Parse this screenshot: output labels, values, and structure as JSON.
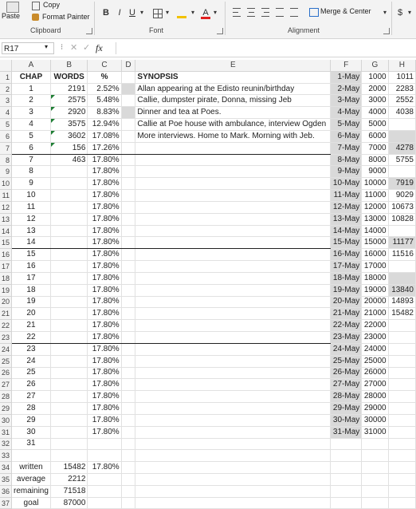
{
  "ribbon": {
    "clipboard": {
      "paste": "Paste",
      "copy": "Copy",
      "format_painter": "Format Painter",
      "label": "Clipboard"
    },
    "font": {
      "bold": "B",
      "italic": "I",
      "underline": "U",
      "font_color": "A",
      "label": "Font"
    },
    "alignment": {
      "merge_center": "Merge & Center",
      "label": "Alignment"
    },
    "number": {
      "currency": "$"
    }
  },
  "formula_bar": {
    "name_box": "R17",
    "fx": "fx",
    "value": ""
  },
  "columns": [
    "A",
    "B",
    "C",
    "D",
    "E",
    "F",
    "G",
    "H"
  ],
  "header_row": {
    "chap": "CHAP",
    "words": "WORDS",
    "pct": "%",
    "synopsis": "SYNOPSIS"
  },
  "rows": [
    {
      "n": "1",
      "a": "CHAP",
      "b": "WORDS",
      "c": "%",
      "e": "SYNOPSIS",
      "f": "1-May",
      "g": "1000",
      "h": "1011"
    },
    {
      "n": "2",
      "a": "1",
      "b": "2191",
      "c": "2.52%",
      "e": "Allan appearing at the Edisto reunin/birthday",
      "f": "2-May",
      "g": "2000",
      "h": "2283"
    },
    {
      "n": "3",
      "a": "2",
      "b": "2575",
      "c": "5.48%",
      "e": "Callie, dumpster pirate, Donna, missing Jeb",
      "f": "3-May",
      "g": "3000",
      "h": "2552"
    },
    {
      "n": "4",
      "a": "3",
      "b": "2920",
      "c": "8.83%",
      "e": "Dinner and tea at Poes.",
      "f": "4-May",
      "g": "4000",
      "h": "4038"
    },
    {
      "n": "5",
      "a": "4",
      "b": "3575",
      "c": "12.94%",
      "e": "Callie at Poe house with ambulance, interview Ogden",
      "f": "5-May",
      "g": "5000",
      "h": ""
    },
    {
      "n": "6",
      "a": "5",
      "b": "3602",
      "c": "17.08%",
      "e": "More interviews. Home to Mark. Morning with Jeb.",
      "f": "6-May",
      "g": "6000",
      "h": ""
    },
    {
      "n": "7",
      "a": "6",
      "b": "156",
      "c": "17.26%",
      "e": "",
      "f": "7-May",
      "g": "7000",
      "h": "4278"
    },
    {
      "n": "8",
      "a": "7",
      "b": "463",
      "c": "17.80%",
      "e": "",
      "f": "8-May",
      "g": "8000",
      "h": "5755"
    },
    {
      "n": "9",
      "a": "8",
      "b": "",
      "c": "17.80%",
      "e": "",
      "f": "9-May",
      "g": "9000",
      "h": ""
    },
    {
      "n": "10",
      "a": "9",
      "b": "",
      "c": "17.80%",
      "e": "",
      "f": "10-May",
      "g": "10000",
      "h": "7919"
    },
    {
      "n": "11",
      "a": "10",
      "b": "",
      "c": "17.80%",
      "e": "",
      "f": "11-May",
      "g": "11000",
      "h": "9029"
    },
    {
      "n": "12",
      "a": "11",
      "b": "",
      "c": "17.80%",
      "e": "",
      "f": "12-May",
      "g": "12000",
      "h": "10673"
    },
    {
      "n": "13",
      "a": "12",
      "b": "",
      "c": "17.80%",
      "e": "",
      "f": "13-May",
      "g": "13000",
      "h": "10828"
    },
    {
      "n": "14",
      "a": "13",
      "b": "",
      "c": "17.80%",
      "e": "",
      "f": "14-May",
      "g": "14000",
      "h": ""
    },
    {
      "n": "15",
      "a": "14",
      "b": "",
      "c": "17.80%",
      "e": "",
      "f": "15-May",
      "g": "15000",
      "h": "11177"
    },
    {
      "n": "16",
      "a": "15",
      "b": "",
      "c": "17.80%",
      "e": "",
      "f": "16-May",
      "g": "16000",
      "h": "11516"
    },
    {
      "n": "17",
      "a": "16",
      "b": "",
      "c": "17.80%",
      "e": "",
      "f": "17-May",
      "g": "17000",
      "h": ""
    },
    {
      "n": "18",
      "a": "17",
      "b": "",
      "c": "17.80%",
      "e": "",
      "f": "18-May",
      "g": "18000",
      "h": ""
    },
    {
      "n": "19",
      "a": "18",
      "b": "",
      "c": "17.80%",
      "e": "",
      "f": "19-May",
      "g": "19000",
      "h": "13840"
    },
    {
      "n": "20",
      "a": "19",
      "b": "",
      "c": "17.80%",
      "e": "",
      "f": "20-May",
      "g": "20000",
      "h": "14893"
    },
    {
      "n": "21",
      "a": "20",
      "b": "",
      "c": "17.80%",
      "e": "",
      "f": "21-May",
      "g": "21000",
      "h": "15482"
    },
    {
      "n": "22",
      "a": "21",
      "b": "",
      "c": "17.80%",
      "e": "",
      "f": "22-May",
      "g": "22000",
      "h": ""
    },
    {
      "n": "23",
      "a": "22",
      "b": "",
      "c": "17.80%",
      "e": "",
      "f": "23-May",
      "g": "23000",
      "h": ""
    },
    {
      "n": "24",
      "a": "23",
      "b": "",
      "c": "17.80%",
      "e": "",
      "f": "24-May",
      "g": "24000",
      "h": ""
    },
    {
      "n": "25",
      "a": "24",
      "b": "",
      "c": "17.80%",
      "e": "",
      "f": "25-May",
      "g": "25000",
      "h": ""
    },
    {
      "n": "26",
      "a": "25",
      "b": "",
      "c": "17.80%",
      "e": "",
      "f": "26-May",
      "g": "26000",
      "h": ""
    },
    {
      "n": "27",
      "a": "26",
      "b": "",
      "c": "17.80%",
      "e": "",
      "f": "27-May",
      "g": "27000",
      "h": ""
    },
    {
      "n": "28",
      "a": "27",
      "b": "",
      "c": "17.80%",
      "e": "",
      "f": "28-May",
      "g": "28000",
      "h": ""
    },
    {
      "n": "29",
      "a": "28",
      "b": "",
      "c": "17.80%",
      "e": "",
      "f": "29-May",
      "g": "29000",
      "h": ""
    },
    {
      "n": "30",
      "a": "29",
      "b": "",
      "c": "17.80%",
      "e": "",
      "f": "30-May",
      "g": "30000",
      "h": ""
    },
    {
      "n": "31",
      "a": "30",
      "b": "",
      "c": "17.80%",
      "e": "",
      "f": "31-May",
      "g": "31000",
      "h": ""
    },
    {
      "n": "32",
      "a": "31",
      "b": "",
      "c": "",
      "e": "",
      "f": "",
      "g": "",
      "h": ""
    },
    {
      "n": "33",
      "a": "",
      "b": "",
      "c": "",
      "e": "",
      "f": "",
      "g": "",
      "h": ""
    },
    {
      "n": "34",
      "a": "written",
      "b": "15482",
      "c": "17.80%",
      "e": "",
      "f": "",
      "g": "",
      "h": ""
    },
    {
      "n": "35",
      "a": "average",
      "b": "2212",
      "c": "",
      "e": "",
      "f": "",
      "g": "",
      "h": ""
    },
    {
      "n": "36",
      "a": "remaining",
      "b": "71518",
      "c": "",
      "e": "",
      "f": "",
      "g": "",
      "h": ""
    },
    {
      "n": "37",
      "a": "goal",
      "b": "87000",
      "c": "",
      "e": "",
      "f": "",
      "g": "",
      "h": ""
    }
  ]
}
